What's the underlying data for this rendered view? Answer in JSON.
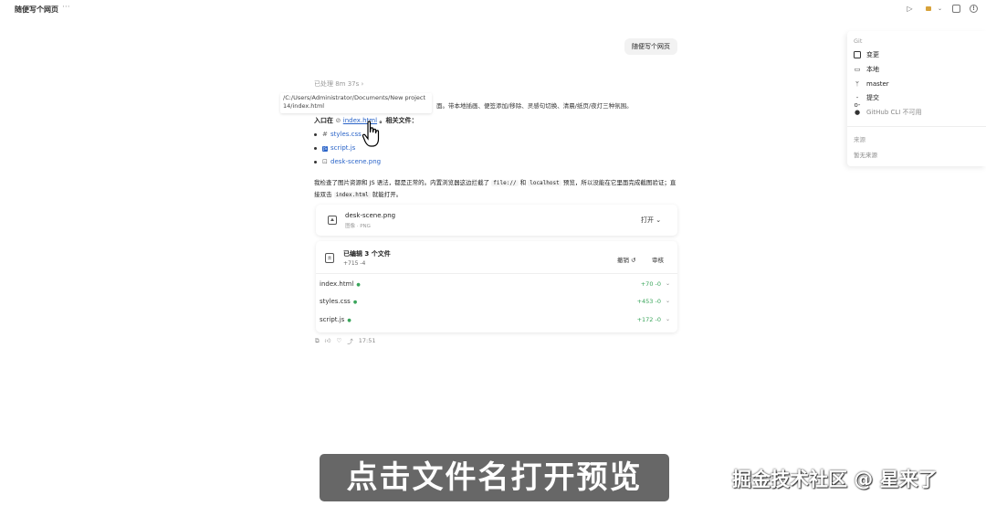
{
  "topbar": {
    "title": "随便写个网页",
    "more": "···",
    "play_icon": "play-icon",
    "folder_icon": "folder-icon",
    "panel_icon": "panel-toggle-icon",
    "info_icon": "info-icon"
  },
  "user_message": "随便写个网页",
  "right_panel": {
    "git_label": "Git",
    "items": [
      {
        "icon": "changes-icon",
        "label": "变更"
      },
      {
        "icon": "laptop-icon",
        "label": "本地"
      },
      {
        "icon": "branch-icon",
        "label": "master"
      },
      {
        "icon": "commit-icon",
        "label": "提交"
      },
      {
        "icon": "github-icon",
        "label": "GitHub CLI 不可用"
      }
    ],
    "source_label": "来源",
    "no_source": "暂无来源"
  },
  "assistant": {
    "processed": "已处理 8m 37s ›",
    "path_line1": "/C:/Users/Administrator/Documents/New project",
    "path_line2": "14/index.html",
    "intro_tail": "面。带本地插画、便签添加/移除、灵感句切换、清晨/纸页/夜灯三种氛围。",
    "entry_prefix": "入口在",
    "entry_link": "index.html",
    "entry_suffix": "。相关文件：",
    "files": [
      "styles.css",
      "script.js",
      "desk-scene.png"
    ],
    "para_part1": "我检查了图片资源和 JS 语法，都是正常的。内置浏览器这边拦截了",
    "para_code1": "file://",
    "para_part2": "和",
    "para_code2": "localhost",
    "para_part3": "预览，所以没能在它里面完成截图验证；直接双击",
    "para_code3": "index.html",
    "para_part4": "就能打开。"
  },
  "attachment": {
    "name": "desk-scene.png",
    "meta": "图像 · PNG",
    "open_label": "打开 ⌄"
  },
  "edits": {
    "title": "已编辑 3 个文件",
    "stats": "+715 -4",
    "undo_label": "撤销 ↺",
    "review_label": "审核",
    "rows": [
      {
        "name": "index.html",
        "diff": "+70 -0"
      },
      {
        "name": "styles.css",
        "diff": "+453 -0"
      },
      {
        "name": "script.js",
        "diff": "+172 -0"
      }
    ]
  },
  "footer": {
    "time": "17:51",
    "icons": [
      "copy-icon",
      "thumbs-up-icon",
      "thumbs-down-icon",
      "share-icon"
    ]
  },
  "subtitle": "点击文件名打开预览",
  "watermark": "掘金技术社区 @ 星来了"
}
